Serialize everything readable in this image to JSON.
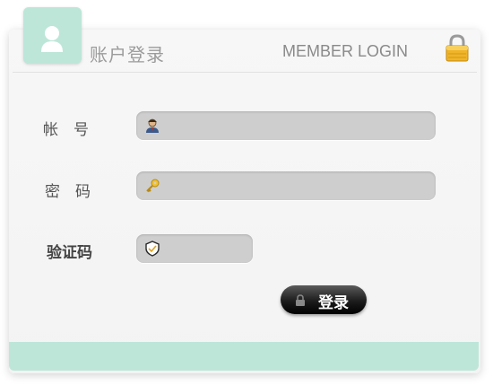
{
  "header": {
    "title_cn": "账户登录",
    "title_en": "MEMBER LOGIN"
  },
  "form": {
    "account": {
      "label": "帐　号",
      "value": ""
    },
    "password": {
      "label": "密　码",
      "value": ""
    },
    "captcha": {
      "label": "验证码",
      "value": ""
    }
  },
  "login_button": {
    "label": "登录"
  },
  "colors": {
    "accent": "#bde6d9",
    "field_bg": "#cecece",
    "button_dark": "#1c1c1c"
  },
  "icons": {
    "avatar": "user-silhouette-icon",
    "lock": "padlock-icon",
    "account_field": "user-icon",
    "password_field": "key-icon",
    "captcha_field": "shield-check-icon",
    "button": "small-lock-icon"
  }
}
